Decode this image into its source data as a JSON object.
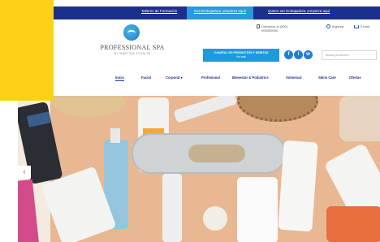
{
  "topbar": {
    "link1": "Talleres de Formación",
    "link2": "Sea Embajadora ¡empieza aquí!",
    "link3": "Quiero ser Embajadora ¡empieza aquí"
  },
  "header": {
    "brand": "PROFESSIONAL SPA",
    "brand_sub": "BY MARTINA ROVALTA",
    "contact_line1": "Llámanos al (000)",
    "contact_line2": "000000000",
    "user_label": "Ingresar",
    "cart_label": "0 total",
    "cta_line1": "CANJEA LOS PRODUCTOS Y DEBITAS",
    "cta_line2": "Ver más",
    "social": [
      "f",
      "i",
      "w"
    ],
    "search_placeholder": "Buscar productos..."
  },
  "nav": {
    "items": [
      "Inicio",
      "Facial",
      "Corporal ▾",
      "Profesional",
      "Bienestar & Podiatrics",
      "Solmeical",
      "Skins Care",
      "Ofertas"
    ]
  },
  "hero": {
    "arrow": "‹"
  },
  "colors": {
    "topbar": "#1b2f8c",
    "accent": "#1f9bdc",
    "overlay": "#fcd116",
    "hero_bg": "#e8b893"
  }
}
